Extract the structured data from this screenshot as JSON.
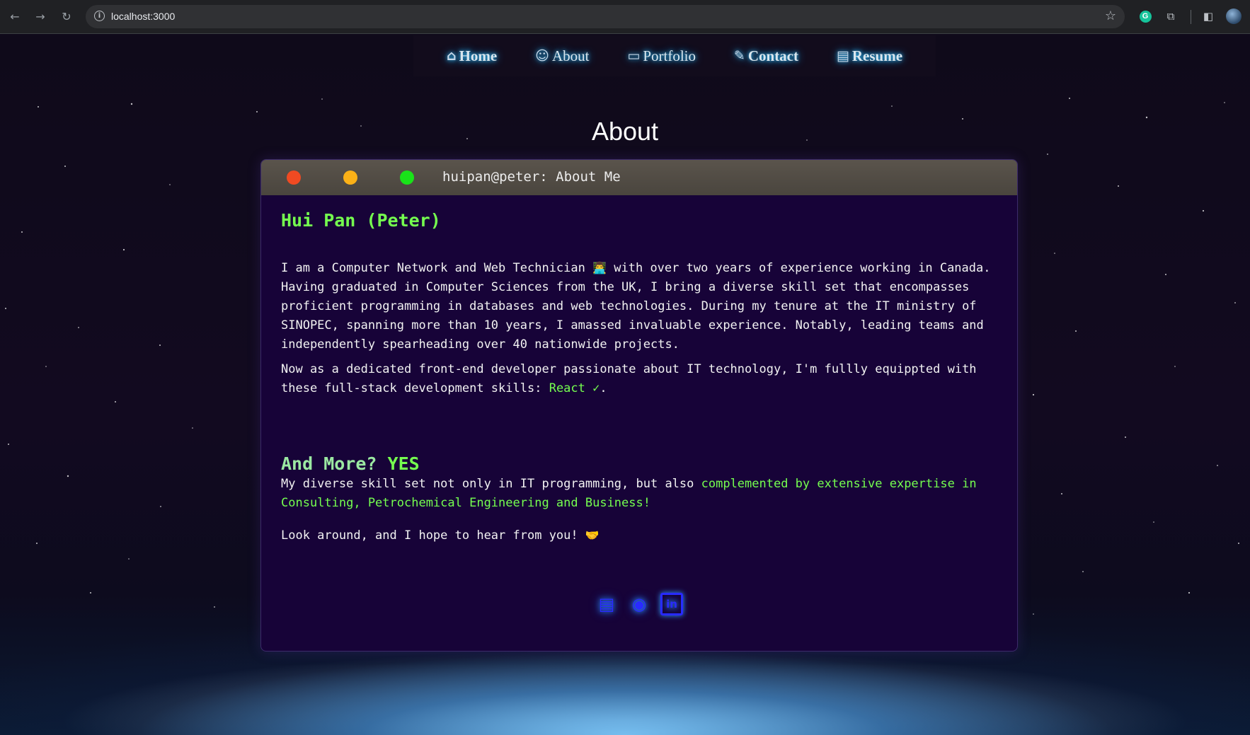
{
  "browser": {
    "url": "localhost:3000",
    "back_icon": "←",
    "forward_icon": "→",
    "reload_icon": "↻",
    "info_icon": "i",
    "bookmark_icon": "☆",
    "grammarly_icon": "G",
    "extensions_icon": "⧉",
    "sidebar_icon": "◧"
  },
  "nav": {
    "items": [
      {
        "label": "Home",
        "icon": "⌂"
      },
      {
        "label": "About",
        "icon": "☺"
      },
      {
        "label": "Portfolio",
        "icon": "▭"
      },
      {
        "label": "Contact",
        "icon": "✎"
      },
      {
        "label": "Resume",
        "icon": "▤"
      }
    ]
  },
  "page": {
    "title": "About"
  },
  "terminal": {
    "title": "huipan@peter: About Me",
    "name_heading": "Hui Pan (Peter)",
    "para1_pre": "I am a Computer Network and Web Technician ",
    "para1_emoji": "👨‍💻",
    "para1_post": " with over two years of experience working in Canada. Having graduated in Computer Sciences from the UK, I bring a diverse skill set that encompasses proficient programming in databases and web technologies. During my tenure at the IT ministry of SINOPEC, spanning more than 10 years, I amassed invaluable experience. Notably, leading teams and independently spearheading over 40 nationwide projects.",
    "para2_pre": "Now as a dedicated front-end developer passionate about IT technology, I'm fullly equippted with these full-stack development skills: ",
    "para2_skill": "React ✓",
    "para2_post": ".",
    "more_heading": "And More? ",
    "more_heading_answer": "YES",
    "para3_pre": "My diverse skill set not only in IT programming, but also ",
    "para3_highlight": "complemented by extensive expertise in Consulting, Petrochemical Engineering and Business!",
    "para4_text": "Look around, and I hope to hear from you! ",
    "para4_emoji": "🤝",
    "socials": {
      "resume_icon": "▤",
      "github_icon": "◉",
      "linkedin_icon": "in"
    }
  },
  "colors": {
    "accent_green": "#75ff4f",
    "terminal_bg": "#170338",
    "nav_glow": "#33c3ff",
    "social_blue": "#2a2aff"
  }
}
